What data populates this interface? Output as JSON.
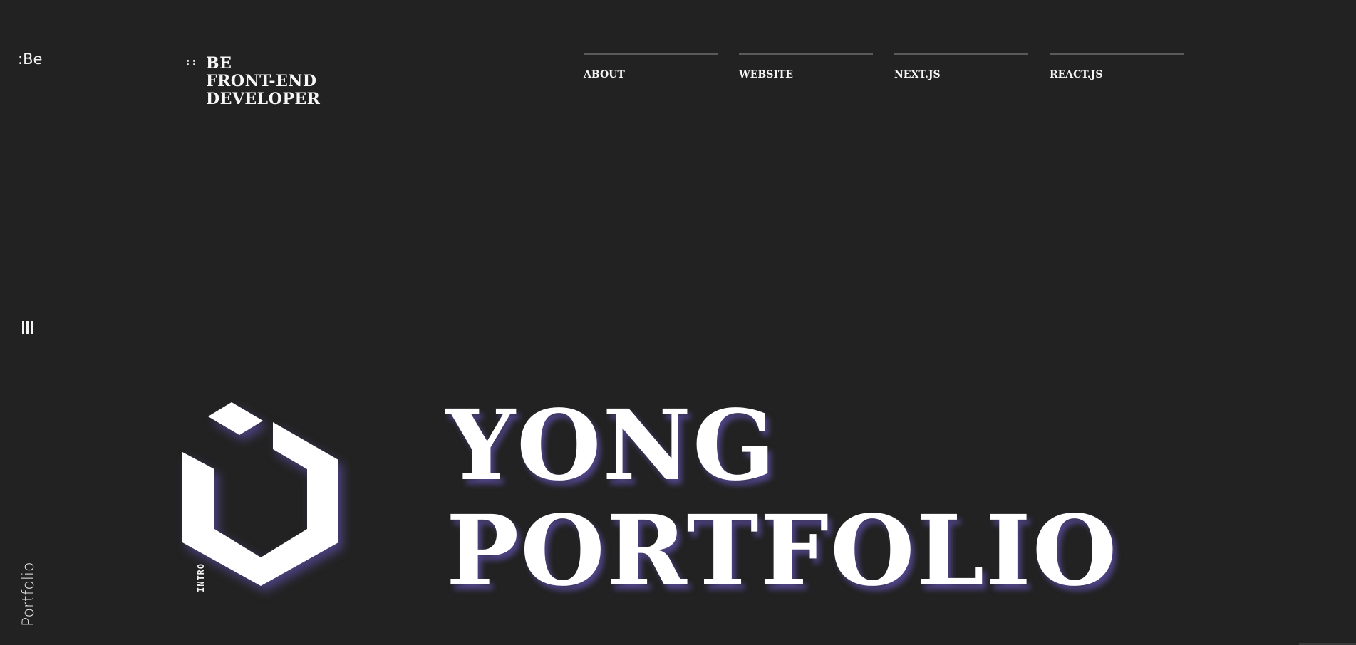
{
  "sidebar": {
    "brand": ":Be",
    "menu_icon": "menu-bars-icon",
    "vertical_label": "Portfolio"
  },
  "header": {
    "tag_marker": "::",
    "tagline": [
      "BE",
      "FRONT-END",
      "DEVELOPER"
    ],
    "nav": [
      {
        "label": "ABOUT"
      },
      {
        "label": "WEBSITE"
      },
      {
        "label": "NEXT.JS"
      },
      {
        "label": "REACT.JS"
      }
    ]
  },
  "hero": {
    "logo_icon": "hexagon-logo-icon",
    "intro_label": "INTRO",
    "title_lines": [
      "YONG",
      "PORTFOLIO"
    ]
  },
  "colors": {
    "background": "#222222",
    "text": "#ffffff",
    "shadow_accent": "#6e5ac8"
  }
}
